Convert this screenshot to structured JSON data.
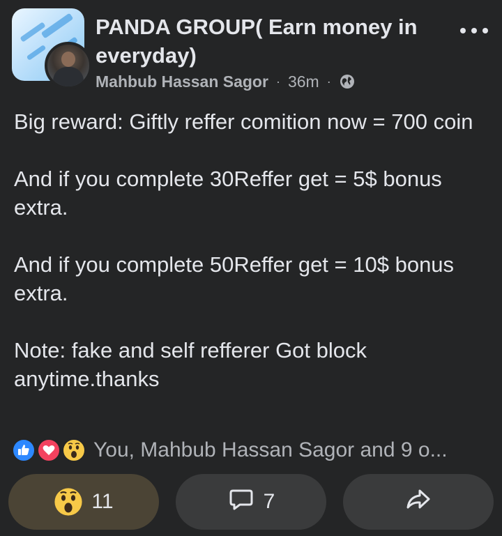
{
  "post": {
    "group_name": "PANDA GROUP( Earn money in everyday)",
    "author": "Mahbub Hassan Sagor",
    "time": "36m",
    "separator": "·",
    "audience_icon": "globe-icon",
    "more_icon": "more-options-icon",
    "paragraphs": [
      "Big reward: Giftly reffer comition now = 700 coin",
      "And if you complete 30Reffer get = 5$ bonus extra.",
      "And if you complete 50Reffer get = 10$ bonus extra.",
      "Note: fake and self refferer Got block anytime.thanks"
    ]
  },
  "reactions": {
    "icons": [
      "like-icon",
      "love-icon",
      "wow-icon"
    ],
    "summary": "You, Mahbub Hassan Sagor and 9 o..."
  },
  "actions": {
    "react_count": "11",
    "comment_count": "7"
  },
  "colors": {
    "background": "#242526",
    "text": "#e4e6eb",
    "secondary_text": "#b0b3b8",
    "button_bg": "#3a3b3c",
    "reacted_button_bg": "#4b4435",
    "like": "#2d88ff",
    "love": "#f3425f",
    "wow": "#f7c948"
  }
}
